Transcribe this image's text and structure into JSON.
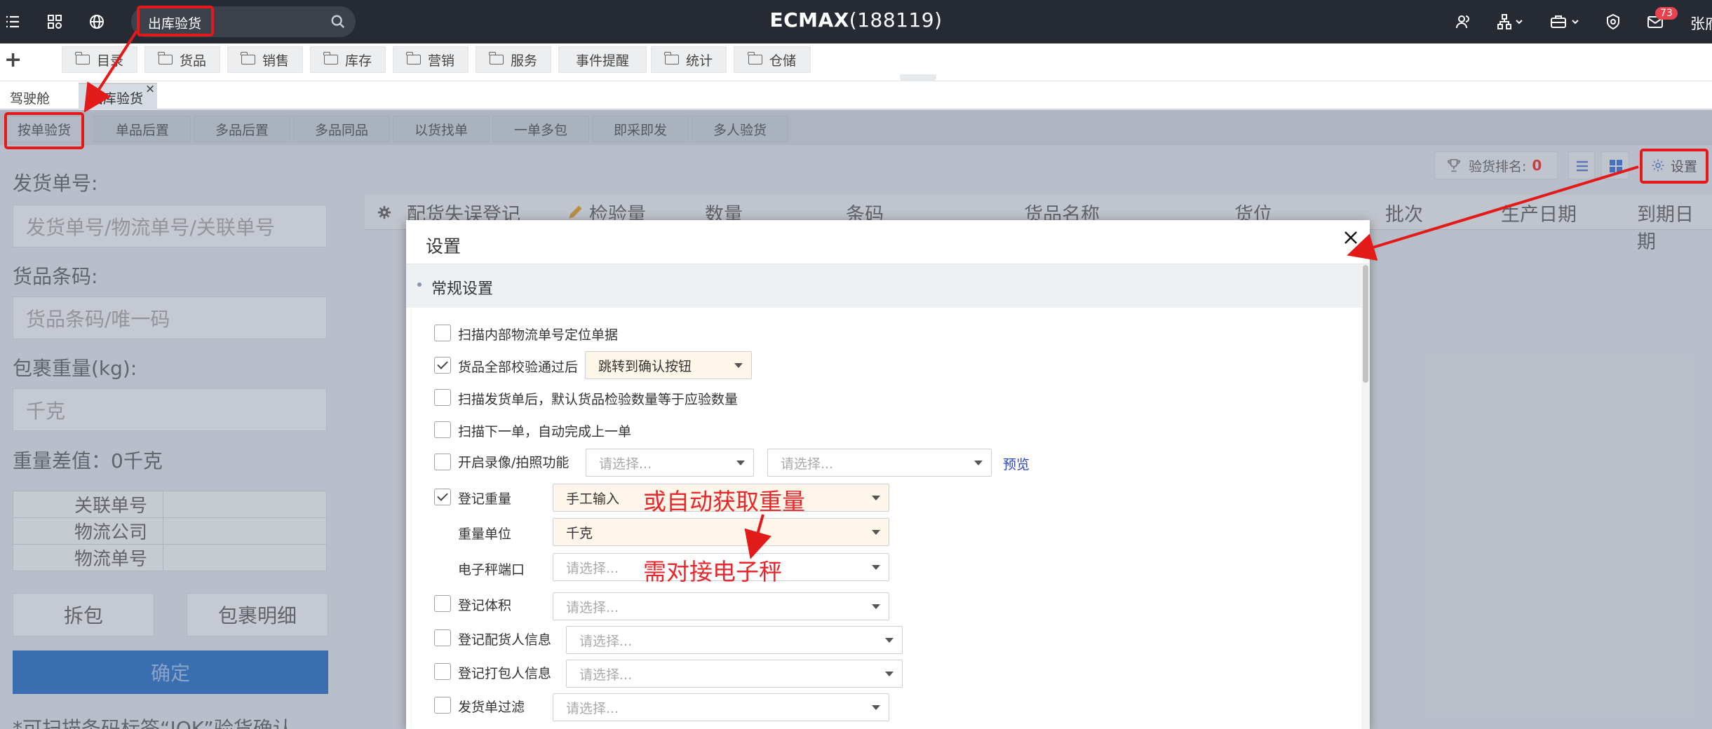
{
  "header": {
    "search_value": "出库验货",
    "app_title": "ECMAX",
    "app_id": "(188119)",
    "notification_count": "73",
    "user_name": "张府"
  },
  "menu": {
    "plus": "+",
    "items": [
      "目录",
      "货品",
      "销售",
      "库存",
      "营销",
      "服务",
      "事件提醒",
      "统计",
      "仓储"
    ]
  },
  "tabs": [
    "驾驶舱",
    "出库验货"
  ],
  "tab_close": "×",
  "subtabs": [
    "按单验货",
    "单品后置",
    "多品后置",
    "多品同品",
    "以货找单",
    "一单多包",
    "即采即发",
    "多人验货"
  ],
  "left": {
    "ship_no_label": "发货单号:",
    "ship_no_placeholder": "发货单号/物流单号/关联单号",
    "barcode_label": "货品条码:",
    "barcode_placeholder": "货品条码/唯一码",
    "weight_label": "包裹重量(kg):",
    "weight_placeholder": "千克",
    "weight_diff": "重量差值：0千克",
    "info_rows": [
      "关联单号",
      "物流公司",
      "物流单号"
    ],
    "split_btn": "拆包",
    "detail_btn": "包裹明细",
    "confirm_btn": "确定",
    "hint": "*可扫描条码标签“JOK”验货确认"
  },
  "toolbar": {
    "rank_label": "验货排名:",
    "rank_value": "0",
    "settings_label": "设置"
  },
  "grid_headers": [
    "配货失误登记",
    "检验量",
    "数量",
    "条码",
    "货品名称",
    "货位",
    "批次",
    "生产日期",
    "到期日期"
  ],
  "modal": {
    "title": "设置",
    "section": "常规设置",
    "options": [
      {
        "label": "扫描内部物流单号定位单据",
        "checked": false
      },
      {
        "label": "货品全部校验通过后",
        "checked": true,
        "select": "跳转到确认按钮"
      },
      {
        "label": "扫描发货单后，默认货品检验数量等于应验数量",
        "checked": false
      },
      {
        "label": "扫描下一单，自动完成上一单",
        "checked": false
      },
      {
        "label": "开启录像/拍照功能",
        "checked": false,
        "select1": "请选择...",
        "select2": "请选择...",
        "link": "预览"
      },
      {
        "label": "登记重量",
        "checked": true,
        "select": "手工输入"
      },
      {
        "label": "重量单位",
        "select": "千克"
      },
      {
        "label": "电子秤端口",
        "select": "请选择..."
      },
      {
        "label": "登记体积",
        "checked": false,
        "select": "请选择..."
      },
      {
        "label": "登记配货人信息",
        "checked": false,
        "select": "请选择..."
      },
      {
        "label": "登记打包人信息",
        "checked": false,
        "select": "请选择..."
      },
      {
        "label": "发货单过滤",
        "checked": false,
        "select": "请选择..."
      }
    ]
  },
  "annotations": {
    "auto_weight": "或自动获取重量",
    "scale": "需对接电子秤"
  },
  "colors": {
    "topbar": "#262b33",
    "annotation": "#e21a1a",
    "confirm": "#2f73c7",
    "link": "#2a46c8"
  }
}
